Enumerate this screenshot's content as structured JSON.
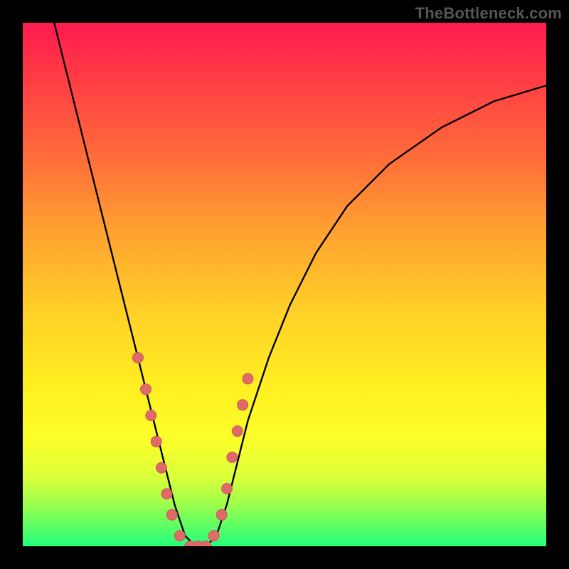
{
  "watermark": "TheBottleneck.com",
  "colors": {
    "frame": "#000000",
    "curve_stroke": "#000000",
    "marker_fill": "#e06a6a",
    "marker_stroke": "#c95a5a",
    "gradient_stops": [
      "#ff1a4f",
      "#ff3a45",
      "#ff6a3a",
      "#ffa230",
      "#ffd027",
      "#fff021",
      "#fbff2a",
      "#d8ff3a",
      "#9dff4d",
      "#5eff63",
      "#22ff7b"
    ]
  },
  "chart_data": {
    "type": "line",
    "title": "",
    "xlabel": "",
    "ylabel": "",
    "xlim": [
      0,
      100
    ],
    "ylim": [
      0,
      100
    ],
    "grid": false,
    "legend": false,
    "series": [
      {
        "name": "bottleneck-curve",
        "x": [
          6,
          10,
          14,
          17,
          19,
          21,
          23,
          25,
          27,
          29,
          31,
          33,
          35,
          37,
          39,
          41,
          43,
          47,
          51,
          56,
          62,
          70,
          80,
          90,
          100
        ],
        "y": [
          100,
          84,
          68,
          56,
          48,
          40,
          32,
          24,
          16,
          8,
          2,
          0,
          0,
          2,
          8,
          16,
          24,
          36,
          46,
          56,
          65,
          73,
          80,
          85,
          88
        ]
      }
    ],
    "markers": {
      "name": "highlighted-points",
      "x": [
        22,
        23.5,
        24.5,
        25.5,
        26.5,
        27.5,
        28.5,
        30,
        32,
        33.5,
        35,
        36.5,
        38,
        39,
        40,
        41,
        42,
        43
      ],
      "y": [
        36,
        30,
        25,
        20,
        15,
        10,
        6,
        2,
        0,
        0,
        0,
        2,
        6,
        11,
        17,
        22,
        27,
        32
      ],
      "shape": "circle",
      "size": 9
    },
    "minimum_x": 33
  }
}
